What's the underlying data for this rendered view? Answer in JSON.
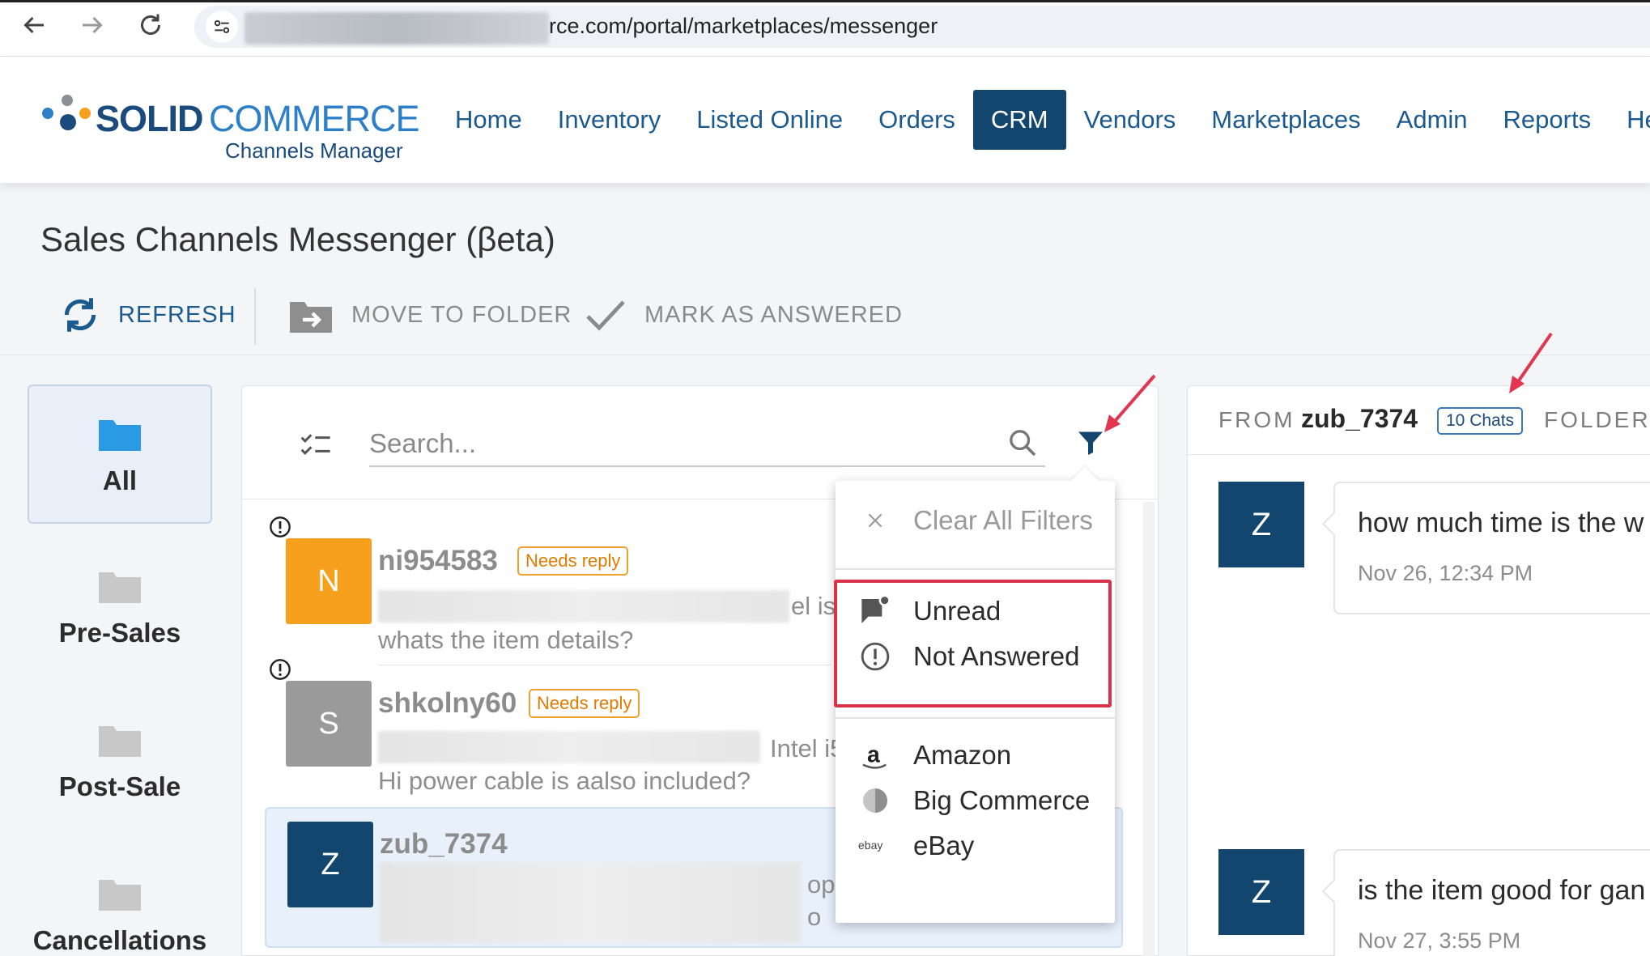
{
  "browser": {
    "url_visible": "rce.com/portal/marketplaces/messenger"
  },
  "logo": {
    "word1": "SOLID",
    "word2": "COMMERCE",
    "subtitle": "Channels Manager"
  },
  "nav": {
    "items": [
      {
        "label": "Home",
        "active": false
      },
      {
        "label": "Inventory",
        "active": false
      },
      {
        "label": "Listed Online",
        "active": false
      },
      {
        "label": "Orders",
        "active": false
      },
      {
        "label": "CRM",
        "active": true
      },
      {
        "label": "Vendors",
        "active": false
      },
      {
        "label": "Marketplaces",
        "active": false
      },
      {
        "label": "Admin",
        "active": false
      },
      {
        "label": "Reports",
        "active": false
      },
      {
        "label": "He",
        "active": false
      }
    ]
  },
  "page": {
    "title": "Sales Channels Messenger (βeta)"
  },
  "toolbar": {
    "refresh_label": "REFRESH",
    "move_label": "MOVE TO FOLDER",
    "mark_label": "MARK AS ANSWERED"
  },
  "folders": [
    {
      "label": "All",
      "selected": true
    },
    {
      "label": "Pre-Sales",
      "selected": false
    },
    {
      "label": "Post-Sale",
      "selected": false
    },
    {
      "label": "Cancellations",
      "selected": false
    }
  ],
  "search": {
    "placeholder": "Search..."
  },
  "messages": [
    {
      "initial": "N",
      "user": "ni954583",
      "badge": "Needs reply",
      "partial": "el is",
      "text": "whats the item details?",
      "color": "#f7a01d"
    },
    {
      "initial": "S",
      "user": "shkolny60",
      "badge": "Needs reply",
      "partial": "Intel i5",
      "text": "Hi power cable is aalso included?",
      "color": "#9a9a9a"
    },
    {
      "initial": "Z",
      "user": "zub_7374",
      "badge": "",
      "partial1": "op",
      "partial2": "o",
      "text": "",
      "color": "#13466f"
    }
  ],
  "filter_menu": {
    "clear_label": "Clear All Filters",
    "status_options": [
      "Unread",
      "Not Answered"
    ],
    "channel_options": [
      "Amazon",
      "Big Commerce",
      "eBay"
    ]
  },
  "chat": {
    "from_label": "FROM",
    "user": "zub_7374",
    "chats_badge": "10 Chats",
    "folder_label": "FOLDER",
    "avatar_initial": "Z",
    "messages": [
      {
        "text": "how much time is the w",
        "time": "Nov 26, 12:34 PM"
      },
      {
        "text": "is the item good for gan",
        "time": "Nov 27, 3:55 PM"
      }
    ]
  },
  "colors": {
    "brand_dark": "#13466f",
    "nav_text": "#1b5a8f",
    "highlight_red": "#d9334b",
    "badge_orange": "#e07b00"
  }
}
